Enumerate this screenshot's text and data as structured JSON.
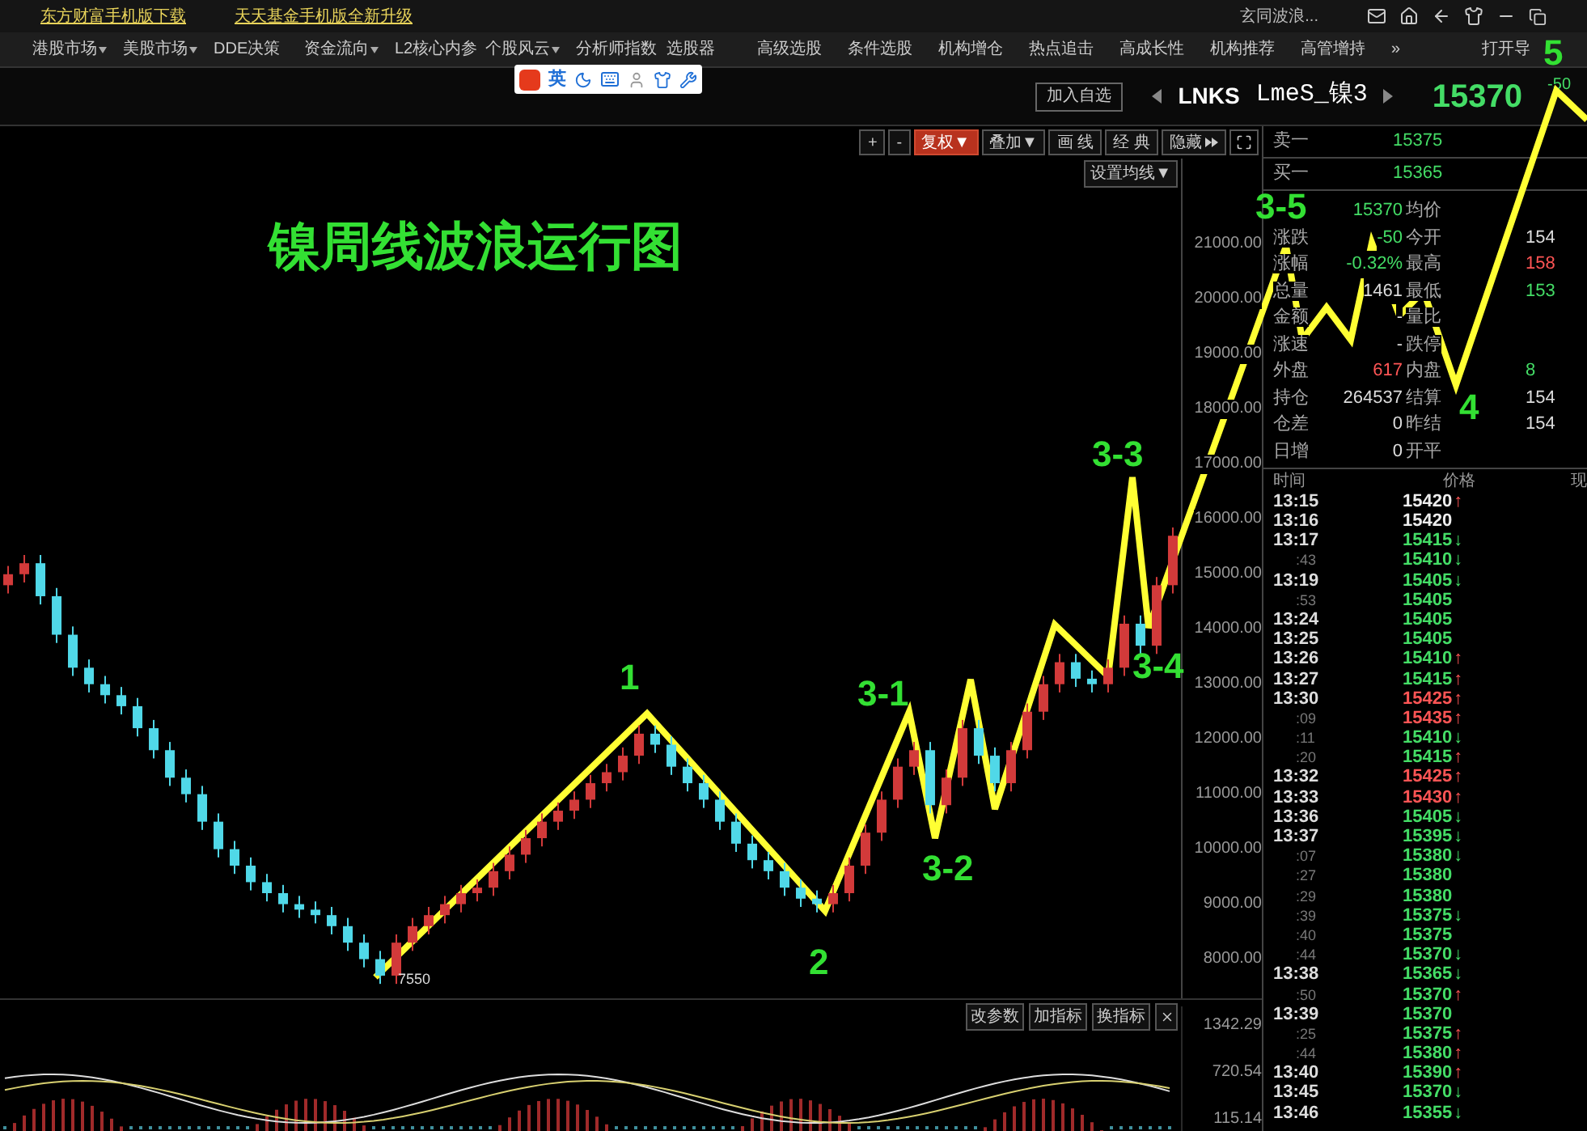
{
  "top_links": [
    "东方财富手机版下载",
    "天天基金手机版全新升级"
  ],
  "user": "玄同波浪...",
  "menu": [
    {
      "label": "港股市场",
      "dropdown": true
    },
    {
      "label": "美股市场",
      "dropdown": true
    },
    {
      "label": "DDE决策",
      "dropdown": false
    },
    {
      "label": "资金流向",
      "dropdown": true
    },
    {
      "label": "L2核心内参",
      "dropdown": false
    },
    {
      "label": "个股风云",
      "dropdown": true
    },
    {
      "label": "分析师指数",
      "dropdown": false
    },
    {
      "label": "选股器",
      "dropdown": false
    },
    {
      "label": "高级选股",
      "dropdown": false
    },
    {
      "label": "条件选股",
      "dropdown": false
    },
    {
      "label": "机构增仓",
      "dropdown": false
    },
    {
      "label": "热点追击",
      "dropdown": false
    },
    {
      "label": "高成长性",
      "dropdown": false
    },
    {
      "label": "机构推荐",
      "dropdown": false
    },
    {
      "label": "高管增持",
      "dropdown": false
    },
    {
      "label": "»",
      "dropdown": false
    },
    {
      "label": "打开导",
      "dropdown": false
    }
  ],
  "ime": {
    "mode": "英"
  },
  "header": {
    "add_button": "加入自选",
    "code": "LNKS",
    "name": "LmeS_镍3",
    "price": "15370",
    "change": "-50"
  },
  "chart_toolbar": [
    {
      "label": "+",
      "selected": false,
      "kind": "text"
    },
    {
      "label": "-",
      "selected": false,
      "kind": "text"
    },
    {
      "label": "复权▼",
      "selected": true,
      "kind": "text"
    },
    {
      "label": "叠加▼",
      "selected": false,
      "kind": "text"
    },
    {
      "label": "画 线",
      "selected": false,
      "kind": "text"
    },
    {
      "label": "经 典",
      "selected": false,
      "kind": "text"
    },
    {
      "label": "隐藏",
      "selected": false,
      "kind": "expand"
    }
  ],
  "ma_setting": "设置均线▼",
  "chart_title": "镍周线波浪运行图",
  "low_label": "7550",
  "chart_data": {
    "type": "candlestick",
    "ylim": [
      7250,
      22550
    ],
    "yticks": [
      {
        "value": 21000,
        "label": "21000.00"
      },
      {
        "value": 20000,
        "label": "20000.00"
      },
      {
        "value": 19000,
        "label": "19000.00"
      },
      {
        "value": 18000,
        "label": "18000.00"
      },
      {
        "value": 17000,
        "label": "17000.00"
      },
      {
        "value": 16000,
        "label": "16000.00"
      },
      {
        "value": 15000,
        "label": "15000.00"
      },
      {
        "value": 14000,
        "label": "14000.00"
      },
      {
        "value": 13000,
        "label": "13000.00"
      },
      {
        "value": 12000,
        "label": "12000.00"
      },
      {
        "value": 11000,
        "label": "11000.00"
      },
      {
        "value": 10000,
        "label": "10000.00"
      },
      {
        "value": 9000,
        "label": "9000.00"
      },
      {
        "value": 8000,
        "label": "8000.00"
      }
    ],
    "ohlc": [
      [
        14800,
        15150,
        14650,
        15000
      ],
      [
        15000,
        15350,
        14850,
        15200
      ],
      [
        15200,
        15350,
        14450,
        14600
      ],
      [
        14600,
        14750,
        13750,
        13900
      ],
      [
        13900,
        14050,
        13150,
        13300
      ],
      [
        13300,
        13450,
        12850,
        13000
      ],
      [
        13000,
        13150,
        12650,
        12800
      ],
      [
        12800,
        12950,
        12450,
        12600
      ],
      [
        12600,
        12750,
        12050,
        12200
      ],
      [
        12200,
        12350,
        11650,
        11800
      ],
      [
        11800,
        11950,
        11150,
        11300
      ],
      [
        11300,
        11450,
        10850,
        11000
      ],
      [
        11000,
        11150,
        10350,
        10500
      ],
      [
        10500,
        10650,
        9850,
        10000
      ],
      [
        10000,
        10150,
        9550,
        9700
      ],
      [
        9700,
        9850,
        9250,
        9400
      ],
      [
        9400,
        9550,
        9050,
        9200
      ],
      [
        9200,
        9350,
        8850,
        9000
      ],
      [
        9000,
        9150,
        8750,
        8900
      ],
      [
        8900,
        9050,
        8650,
        8800
      ],
      [
        8800,
        8950,
        8450,
        8600
      ],
      [
        8600,
        8750,
        8150,
        8300
      ],
      [
        8300,
        8450,
        7850,
        8000
      ],
      [
        8000,
        8150,
        7550,
        7700
      ],
      [
        7700,
        8450,
        7550,
        8300
      ],
      [
        8300,
        8750,
        8150,
        8600
      ],
      [
        8600,
        8950,
        8450,
        8800
      ],
      [
        8800,
        9150,
        8650,
        9000
      ],
      [
        9000,
        9350,
        8850,
        9200
      ],
      [
        9200,
        9450,
        9050,
        9300
      ],
      [
        9300,
        9750,
        9150,
        9600
      ],
      [
        9600,
        10050,
        9450,
        9900
      ],
      [
        9900,
        10350,
        9750,
        10200
      ],
      [
        10200,
        10650,
        10050,
        10500
      ],
      [
        10500,
        10850,
        10350,
        10700
      ],
      [
        10700,
        11050,
        10550,
        10900
      ],
      [
        10900,
        11350,
        10750,
        11200
      ],
      [
        11200,
        11550,
        11050,
        11400
      ],
      [
        11400,
        11850,
        11250,
        11700
      ],
      [
        11700,
        12250,
        11550,
        12100
      ],
      [
        12100,
        12250,
        11750,
        11900
      ],
      [
        11900,
        12050,
        11350,
        11500
      ],
      [
        11500,
        11650,
        11050,
        11200
      ],
      [
        11200,
        11350,
        10750,
        10900
      ],
      [
        10900,
        11050,
        10350,
        10500
      ],
      [
        10500,
        10650,
        9950,
        10100
      ],
      [
        10100,
        10250,
        9650,
        9800
      ],
      [
        9800,
        9950,
        9450,
        9600
      ],
      [
        9600,
        9750,
        9150,
        9300
      ],
      [
        9300,
        9450,
        8950,
        9100
      ],
      [
        9100,
        9250,
        8850,
        9000
      ],
      [
        9000,
        9350,
        8850,
        9200
      ],
      [
        9200,
        9850,
        9050,
        9700
      ],
      [
        9700,
        10450,
        9550,
        10300
      ],
      [
        10300,
        11050,
        10150,
        10900
      ],
      [
        10900,
        11650,
        10750,
        11500
      ],
      [
        11500,
        11950,
        11350,
        11800
      ],
      [
        11800,
        11950,
        10650,
        10800
      ],
      [
        10800,
        11450,
        10650,
        11300
      ],
      [
        11300,
        12350,
        11150,
        12200
      ],
      [
        12200,
        12350,
        11550,
        11700
      ],
      [
        11700,
        11850,
        11050,
        11200
      ],
      [
        11200,
        11950,
        11050,
        11800
      ],
      [
        11800,
        12650,
        11650,
        12500
      ],
      [
        12500,
        13150,
        12350,
        13000
      ],
      [
        13000,
        13550,
        12850,
        13400
      ],
      [
        13400,
        13550,
        12950,
        13100
      ],
      [
        13100,
        13250,
        12850,
        13000
      ],
      [
        13000,
        13450,
        12850,
        13300
      ],
      [
        13300,
        14250,
        13150,
        14100
      ],
      [
        14100,
        14250,
        13550,
        13700
      ],
      [
        13700,
        14950,
        13550,
        14800
      ],
      [
        14800,
        15850,
        14650,
        15700
      ]
    ]
  },
  "wave_labels": [
    "1",
    "2",
    "3-1",
    "3-2",
    "3-3",
    "3-4",
    "3-5",
    "4",
    "5"
  ],
  "indicator": {
    "buttons": [
      "改参数",
      "加指标",
      "换指标"
    ],
    "y_axis": [
      "1342.29",
      "720.54",
      "115.14"
    ]
  },
  "quote": {
    "ask": {
      "label": "卖一",
      "value": "15375"
    },
    "bid": {
      "label": "买一",
      "value": "15365"
    },
    "rows": [
      {
        "left": {
          "value": "15370",
          "color": "#44dd66"
        },
        "right": {
          "label": "均价"
        }
      },
      {
        "left": {
          "label": "涨跌",
          "value": "-50",
          "color": "#44dd66"
        },
        "right": {
          "label": "今开",
          "value": "154",
          "color": "#dddddd"
        }
      },
      {
        "left": {
          "label": "涨幅",
          "value": "-0.32%",
          "color": "#44dd66"
        },
        "right": {
          "label": "最高",
          "value": "158",
          "color": "#ff5555"
        }
      },
      {
        "left": {
          "label": "总量",
          "value": "1461",
          "color": "#dddddd"
        },
        "right": {
          "label": "最低",
          "value": "153",
          "color": "#44dd66"
        }
      },
      {
        "left": {
          "label": "金额",
          "value": "-",
          "color": "#dddddd"
        },
        "right": {
          "label": "量比"
        }
      },
      {
        "left": {
          "label": "涨速",
          "value": "-",
          "color": "#dddddd"
        },
        "right": {
          "label": "跌停"
        }
      },
      {
        "left": {
          "label": "外盘",
          "value": "617",
          "color": "#ff5555"
        },
        "right": {
          "label": "内盘",
          "value": "8",
          "color": "#44dd66"
        }
      },
      {
        "left": {
          "label": "持仓",
          "value": "264537",
          "color": "#dddddd"
        },
        "right": {
          "label": "结算",
          "value": "154",
          "color": "#dddddd"
        }
      },
      {
        "left": {
          "label": "仓差",
          "value": "0",
          "color": "#dddddd"
        },
        "right": {
          "label": "昨结",
          "value": "154",
          "color": "#dddddd"
        }
      },
      {
        "left": {
          "label": "日增",
          "value": "0",
          "color": "#dddddd"
        },
        "right": {
          "label": "开平"
        }
      }
    ]
  },
  "trades_header": [
    "时间",
    "价格",
    "现"
  ],
  "trades": [
    {
      "time": "13:15",
      "minor": false,
      "price": "15420",
      "color": "#eeeeee",
      "arrow": "↑",
      "rising": true
    },
    {
      "time": "13:16",
      "minor": false,
      "price": "15420",
      "color": "#eeeeee"
    },
    {
      "time": "13:17",
      "minor": false,
      "price": "15415",
      "color": "#44dd66",
      "arrow": "↓",
      "rising": false
    },
    {
      "time": ":43",
      "minor": true,
      "price": "15410",
      "color": "#44dd66",
      "arrow": "↓",
      "rising": false
    },
    {
      "time": "13:19",
      "minor": false,
      "price": "15405",
      "color": "#44dd66",
      "arrow": "↓",
      "rising": false
    },
    {
      "time": ":53",
      "minor": true,
      "price": "15405",
      "color": "#44dd66"
    },
    {
      "time": "13:24",
      "minor": false,
      "price": "15405",
      "color": "#44dd66"
    },
    {
      "time": "13:25",
      "minor": false,
      "price": "15405",
      "color": "#44dd66"
    },
    {
      "time": "13:26",
      "minor": false,
      "price": "15410",
      "color": "#44dd66",
      "arrow": "↑",
      "rising": true
    },
    {
      "time": "13:27",
      "minor": false,
      "price": "15415",
      "color": "#44dd66",
      "arrow": "↑",
      "rising": true
    },
    {
      "time": "13:30",
      "minor": false,
      "price": "15425",
      "color": "#ff5555",
      "arrow": "↑",
      "rising": true
    },
    {
      "time": ":09",
      "minor": true,
      "price": "15435",
      "color": "#ff5555",
      "arrow": "↑",
      "rising": true
    },
    {
      "time": ":11",
      "minor": true,
      "price": "15410",
      "color": "#44dd66",
      "arrow": "↓",
      "rising": false
    },
    {
      "time": ":20",
      "minor": true,
      "price": "15415",
      "color": "#44dd66",
      "arrow": "↑",
      "rising": true
    },
    {
      "time": "13:32",
      "minor": false,
      "price": "15425",
      "color": "#ff5555",
      "arrow": "↑",
      "rising": true
    },
    {
      "time": "13:33",
      "minor": false,
      "price": "15430",
      "color": "#ff5555",
      "arrow": "↑",
      "rising": true
    },
    {
      "time": "13:36",
      "minor": false,
      "price": "15405",
      "color": "#44dd66",
      "arrow": "↓",
      "rising": false
    },
    {
      "time": "13:37",
      "minor": false,
      "price": "15395",
      "color": "#44dd66",
      "arrow": "↓",
      "rising": false
    },
    {
      "time": ":07",
      "minor": true,
      "price": "15380",
      "color": "#44dd66",
      "arrow": "↓",
      "rising": false
    },
    {
      "time": ":27",
      "minor": true,
      "price": "15380",
      "color": "#44dd66"
    },
    {
      "time": ":29",
      "minor": true,
      "price": "15380",
      "color": "#44dd66"
    },
    {
      "time": ":39",
      "minor": true,
      "price": "15375",
      "color": "#44dd66",
      "arrow": "↓",
      "rising": false
    },
    {
      "time": ":40",
      "minor": true,
      "price": "15375",
      "color": "#44dd66"
    },
    {
      "time": ":44",
      "minor": true,
      "price": "15370",
      "color": "#44dd66",
      "arrow": "↓",
      "rising": false
    },
    {
      "time": "13:38",
      "minor": false,
      "price": "15365",
      "color": "#44dd66",
      "arrow": "↓",
      "rising": false
    },
    {
      "time": ":50",
      "minor": true,
      "price": "15370",
      "color": "#44dd66",
      "arrow": "↑",
      "rising": true
    },
    {
      "time": "13:39",
      "minor": false,
      "price": "15370",
      "color": "#44dd66"
    },
    {
      "time": ":25",
      "minor": true,
      "price": "15375",
      "color": "#44dd66",
      "arrow": "↑",
      "rising": true
    },
    {
      "time": ":44",
      "minor": true,
      "price": "15380",
      "color": "#44dd66",
      "arrow": "↑",
      "rising": true
    },
    {
      "time": "13:40",
      "minor": false,
      "price": "15390",
      "color": "#44dd66",
      "arrow": "↑",
      "rising": true
    },
    {
      "time": "13:45",
      "minor": false,
      "price": "15370",
      "color": "#44dd66",
      "arrow": "↓",
      "rising": false
    },
    {
      "time": "13:46",
      "minor": false,
      "price": "15355",
      "color": "#44dd66",
      "arrow": "↓",
      "rising": false
    }
  ]
}
